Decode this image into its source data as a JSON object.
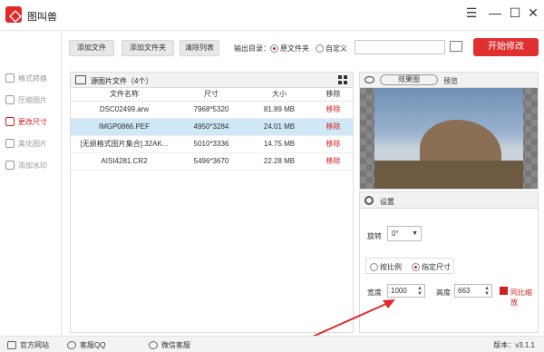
{
  "app": {
    "title": "图叫兽"
  },
  "window": {
    "menu_icon": "menu-icon",
    "minimize": "minimize-icon",
    "maximize": "maximize-icon",
    "close": "close-icon"
  },
  "sidebar": {
    "items": [
      {
        "label": "格式转换",
        "active": false
      },
      {
        "label": "压缩图片",
        "active": false
      },
      {
        "label": "更改尺寸",
        "active": true
      },
      {
        "label": "美化图片",
        "active": false
      },
      {
        "label": "添加水印",
        "active": false
      }
    ]
  },
  "toolbar": {
    "add_file": "添加文件",
    "add_folder": "添加文件夹",
    "clear_list": "清除列表",
    "output_label": "输出目录：",
    "opt_source": "原文件夹",
    "opt_custom": "自定义",
    "path_value": "",
    "start": "开始修改"
  },
  "list": {
    "title": "源图片文件（4个）",
    "headers": [
      "文件名称",
      "尺寸",
      "大小",
      "移除"
    ],
    "rows": [
      {
        "name": "DSC02499.arw",
        "size": "7968*5320",
        "filesize": "81.89 MB",
        "remove": "移除",
        "selected": false
      },
      {
        "name": "IMGP0866.PEF",
        "size": "4950*3284",
        "filesize": "24.01 MB",
        "remove": "移除",
        "selected": true
      },
      {
        "name": "[无损格式图片集合].32AK...",
        "size": "5010*3336",
        "filesize": "14.75 MB",
        "remove": "移除",
        "selected": false
      },
      {
        "name": "AISI4281.CR2",
        "size": "5496*3670",
        "filesize": "22.28 MB",
        "remove": "移除",
        "selected": false
      }
    ]
  },
  "preview": {
    "effect": "效果图",
    "label": "预览"
  },
  "settings": {
    "title": "设置",
    "rotate_label": "旋转",
    "rotate_value": "0°",
    "opt_ratio": "按比例",
    "opt_fixed": "指定尺寸",
    "width_label": "宽度",
    "width_value": "1000",
    "height_label": "高度",
    "height_value": "663",
    "keep_ratio": "同比缩放"
  },
  "footer": {
    "website": "官方网站",
    "qq": "客服QQ",
    "wechat": "微信客服",
    "version": "版本：v3.1.1"
  },
  "colors": {
    "accent": "#e03030",
    "selected_row": "#cfe8f8"
  }
}
